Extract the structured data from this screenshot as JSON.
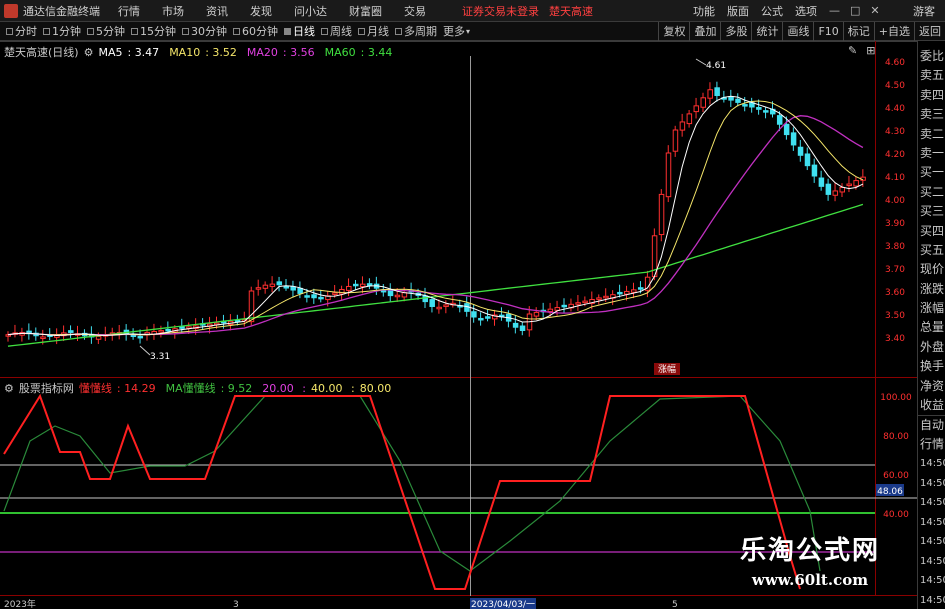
{
  "titlebar": {
    "app_title": "通达信金融终端",
    "menus": [
      "行情",
      "市场",
      "资讯",
      "发现",
      "问小达",
      "财富圈",
      "交易"
    ],
    "login_text": "证券交易未登录",
    "quick_text": "楚天高速",
    "right_menus": [
      "功能",
      "版面",
      "公式",
      "选项"
    ],
    "guest": "游客"
  },
  "toolbar": {
    "periods": [
      "分时",
      "1分钟",
      "5分钟",
      "15分钟",
      "30分钟",
      "60分钟",
      "日线",
      "周线",
      "月线",
      "多周期",
      "更多"
    ],
    "active_period": "日线",
    "right_buttons": [
      "复权",
      "叠加",
      "多股",
      "统计",
      "画线",
      "F10",
      "标记",
      "+自选",
      "返回"
    ]
  },
  "main_chart": {
    "stock_title": "楚天高速(日线)",
    "ma_labels": [
      {
        "name": "MA5",
        "value": "3.47",
        "color": "#ffffff"
      },
      {
        "name": "MA10",
        "value": "3.52",
        "color": "#f5e66a"
      },
      {
        "name": "MA20",
        "value": "3.56",
        "color": "#e040e0"
      },
      {
        "name": "MA60",
        "value": "3.44",
        "color": "#40e040"
      }
    ],
    "price_axis": [
      "4.60",
      "4.50",
      "4.40",
      "4.30",
      "4.20",
      "4.10",
      "4.00",
      "3.90",
      "3.80",
      "3.70",
      "3.60",
      "3.50",
      "3.40"
    ],
    "high_label": "4.61",
    "low_label": "3.31",
    "tag_label": "涨幅"
  },
  "sub_chart": {
    "indicator_name": "股票指标网",
    "line1_label": "懂懂线",
    "line1_value": "14.29",
    "line2_label": "MA懂懂线",
    "line2_value": "9.52",
    "levels": [
      "20.00",
      "40.00",
      "80.00"
    ],
    "axis": [
      "100.00",
      "80.00",
      "60.00",
      "40.00"
    ],
    "current_value": "48.06"
  },
  "date_axis": {
    "start": "2023年",
    "mark1": "3",
    "cursor_date": "2023/04/03/一",
    "mark2": "5"
  },
  "sidepanel": {
    "items": [
      "委比",
      "卖五",
      "卖四",
      "卖三",
      "卖二",
      "卖一",
      "买一",
      "买二",
      "买三",
      "买四",
      "买五",
      "现价",
      "涨跌",
      "涨幅",
      "总量",
      "外盘",
      "换手",
      "净资",
      "收益"
    ],
    "lower_items": [
      "自动",
      "行情"
    ],
    "times": [
      "14:50",
      "14:50",
      "14:50",
      "14:50",
      "14:50",
      "14:50",
      "14:50",
      "14:50"
    ]
  },
  "watermark": {
    "cn": "乐淘公式网",
    "url": "www.60lt.com"
  },
  "colors": {
    "up": "#ff3030",
    "down": "#40e0f0",
    "ma5": "#ffffff",
    "ma10": "#f5e66a",
    "ma20": "#e040e0",
    "ma60": "#40e040",
    "ind_red": "#ff2020",
    "ind_green": "#2a8a3a"
  }
}
